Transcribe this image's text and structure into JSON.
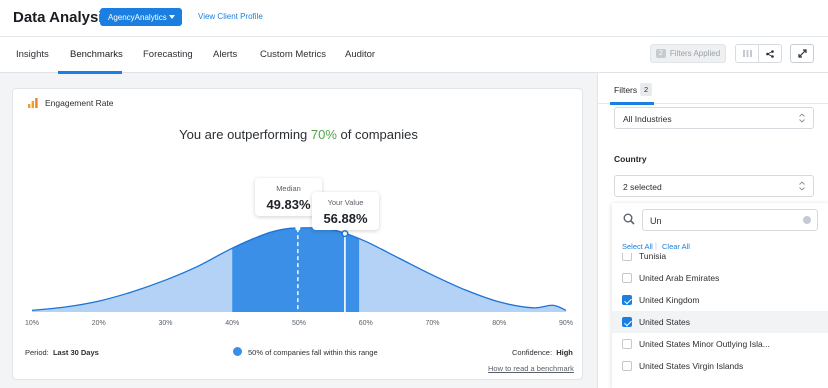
{
  "header": {
    "app_title": "Data Analysis",
    "client_dropdown": "AgencyAnalytics",
    "view_profile": "View Client Profile"
  },
  "tabs": [
    {
      "label": "Insights"
    },
    {
      "label": "Benchmarks"
    },
    {
      "label": "Forecasting"
    },
    {
      "label": "Alerts"
    },
    {
      "label": "Custom Metrics"
    },
    {
      "label": "Auditor"
    }
  ],
  "toolbar": {
    "filters_applied_count": "2",
    "filters_applied_label": "Filters Applied"
  },
  "card": {
    "title": "Engagement Rate",
    "headline_prefix": "You are outperforming ",
    "headline_pct": "70%",
    "headline_suffix": " of companies",
    "median_label": "Median",
    "median_value": "49.83%",
    "your_label": "Your Value",
    "your_value": "56.88%",
    "period_label": "Period:",
    "period_value": "Last 30 Days",
    "legend_text": "50% of companies fall within this range",
    "confidence_label": "Confidence:",
    "confidence_value": "High",
    "how_link": "How to read a benchmark"
  },
  "chart_data": {
    "type": "area",
    "x_ticks": [
      "10%",
      "20%",
      "30%",
      "40%",
      "50%",
      "60%",
      "70%",
      "80%",
      "90%"
    ],
    "xlim": [
      10,
      90
    ],
    "distribution": {
      "x": [
        10,
        15,
        20,
        25,
        30,
        35,
        40,
        45,
        48,
        50,
        53,
        56,
        60,
        65,
        70,
        75,
        80,
        85,
        88,
        90
      ],
      "y": [
        0.02,
        0.06,
        0.13,
        0.24,
        0.38,
        0.55,
        0.76,
        0.93,
        0.99,
        1.0,
        1.0,
        0.96,
        0.84,
        0.64,
        0.44,
        0.26,
        0.12,
        0.05,
        0.08,
        0.02
      ]
    },
    "interquartile_range": [
      40,
      59
    ],
    "median": 49.83,
    "your_value": 56.88,
    "colors": {
      "fill_light": "#b3d2f5",
      "fill_dark": "#3b8fe6",
      "line": "#1a73d9"
    }
  },
  "filters": {
    "title": "Filters",
    "count": "2",
    "industry_value": "All Industries",
    "country_label": "Country",
    "country_value": "2 selected",
    "search_value": "Un",
    "select_all": "Select All",
    "clear_all": "Clear All",
    "options": [
      {
        "label": "Tunisia",
        "checked": false,
        "highlighted": false
      },
      {
        "label": "United Arab Emirates",
        "checked": false,
        "highlighted": false
      },
      {
        "label": "United Kingdom",
        "checked": true,
        "highlighted": false
      },
      {
        "label": "United States",
        "checked": true,
        "highlighted": true
      },
      {
        "label": "United States Minor Outlying Isla...",
        "checked": false,
        "highlighted": false
      },
      {
        "label": "United States Virgin Islands",
        "checked": false,
        "highlighted": false
      }
    ]
  }
}
